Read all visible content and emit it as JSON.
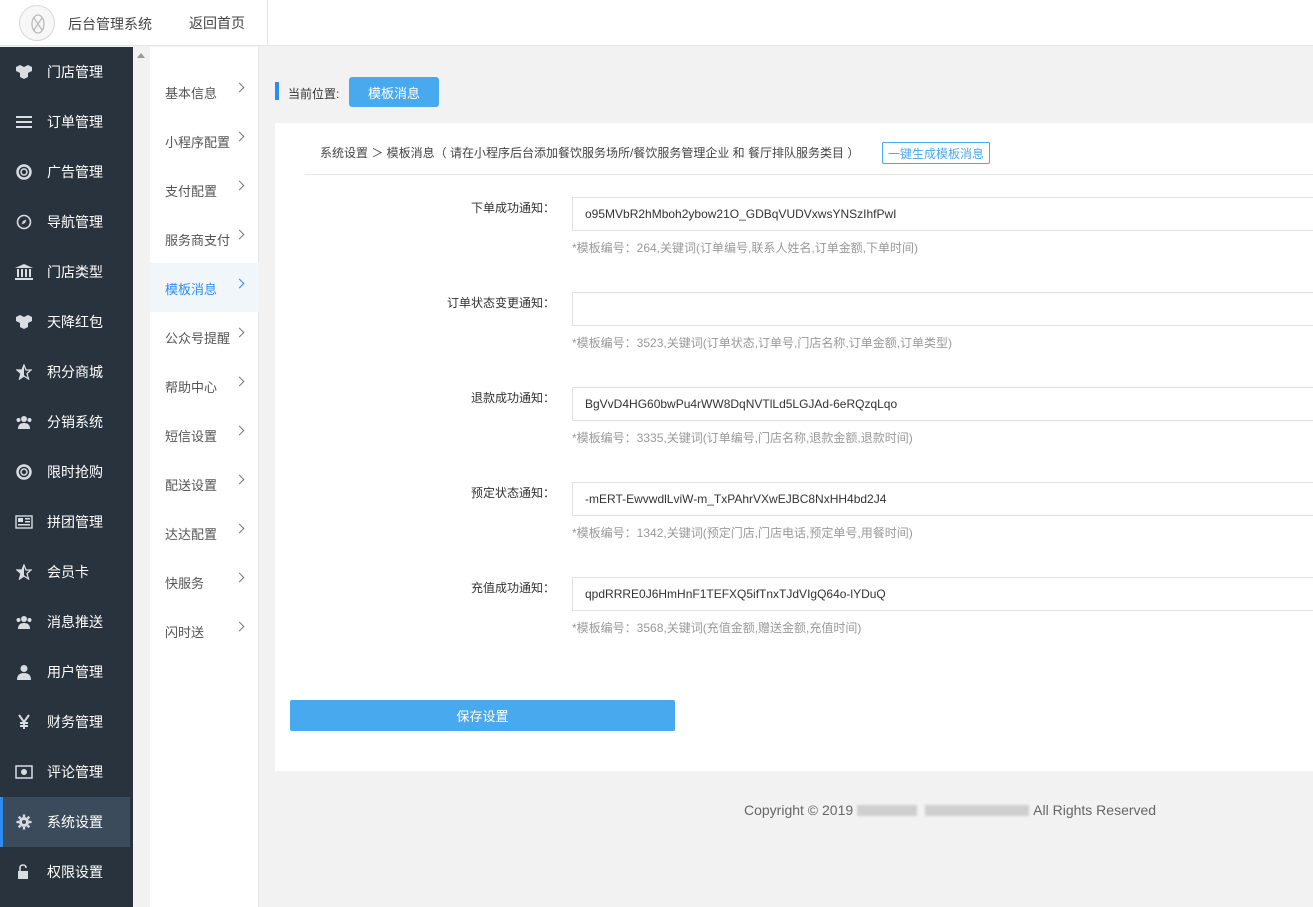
{
  "header": {
    "app_title": "后台管理系统",
    "home_link": "返回首页"
  },
  "sidebar": {
    "items": [
      {
        "label": "门店管理",
        "icon": "cubes-icon"
      },
      {
        "label": "订单管理",
        "icon": "list-icon"
      },
      {
        "label": "广告管理",
        "icon": "lifebuoy-icon"
      },
      {
        "label": "导航管理",
        "icon": "compass-icon"
      },
      {
        "label": "门店类型",
        "icon": "bank-icon"
      },
      {
        "label": "天降红包",
        "icon": "cubes-icon"
      },
      {
        "label": "积分商城",
        "icon": "star-half-icon"
      },
      {
        "label": "分销系统",
        "icon": "users-icon"
      },
      {
        "label": "限时抢购",
        "icon": "lifebuoy-icon"
      },
      {
        "label": "拼团管理",
        "icon": "newspaper-icon"
      },
      {
        "label": "会员卡",
        "icon": "star-half-icon"
      },
      {
        "label": "消息推送",
        "icon": "users-icon"
      },
      {
        "label": "用户管理",
        "icon": "user-icon"
      },
      {
        "label": "财务管理",
        "icon": "yen-icon"
      },
      {
        "label": "评论管理",
        "icon": "money-icon"
      },
      {
        "label": "系统设置",
        "icon": "gear-icon"
      },
      {
        "label": "权限设置",
        "icon": "unlock-icon"
      }
    ],
    "active_index": 15
  },
  "submenu": {
    "items": [
      {
        "label": "基本信息"
      },
      {
        "label": "小程序配置"
      },
      {
        "label": "支付配置"
      },
      {
        "label": "服务商支付"
      },
      {
        "label": "模板消息"
      },
      {
        "label": "公众号提醒"
      },
      {
        "label": "帮助中心"
      },
      {
        "label": "短信设置"
      },
      {
        "label": "配送设置"
      },
      {
        "label": "达达配置"
      },
      {
        "label": "快服务"
      },
      {
        "label": "闪时送"
      }
    ],
    "active_index": 4
  },
  "breadcrumb": {
    "label": "当前位置:",
    "current": "模板消息"
  },
  "panel": {
    "head": "系统设置 ＞ 模板消息（ 请在小程序后台添加餐饮服务场所/餐饮服务管理企业 和 餐厅排队服务类目 ）",
    "generate_button": "一键生成模板消息",
    "fields": [
      {
        "label": "下单成功通知：",
        "value": "o95MVbR2hMboh2ybow21O_GDBqVUDVxwsYNSzIhfPwI",
        "hint": "*模板编号：264,关键词(订单编号,联系人姓名,订单金额,下单时间)"
      },
      {
        "label": "订单状态变更通知：",
        "value": "",
        "hint": "*模板编号：3523,关键词(订单状态,订单号,门店名称,订单金额,订单类型)"
      },
      {
        "label": "退款成功通知：",
        "value": "BgVvD4HG60bwPu4rWW8DqNVTlLd5LGJAd-6eRQzqLqo",
        "hint": "*模板编号：3335,关键词(订单编号,门店名称,退款金额,退款时间)"
      },
      {
        "label": "预定状态通知：",
        "value": "-mERT-EwvwdlLviW-m_TxPAhrVXwEJBC8NxHH4bd2J4",
        "hint": "*模板编号：1342,关键词(预定门店,门店电话,预定单号,用餐时间)"
      },
      {
        "label": "充值成功通知：",
        "value": "qpdRRRE0J6HmHnF1TEFXQ5ifTnxTJdVIgQ64o-lYDuQ",
        "hint": "*模板编号：3568,关键词(充值金额,赠送金额,充值时间)"
      }
    ],
    "save_button": "保存设置"
  },
  "footer": {
    "prefix": "Copyright © 2019",
    "suffix": "All Rights Reserved"
  },
  "colors": {
    "accent": "#49a9ee",
    "sidebar_bg": "#28333e",
    "sidebar_active": "#3c4b5c"
  }
}
